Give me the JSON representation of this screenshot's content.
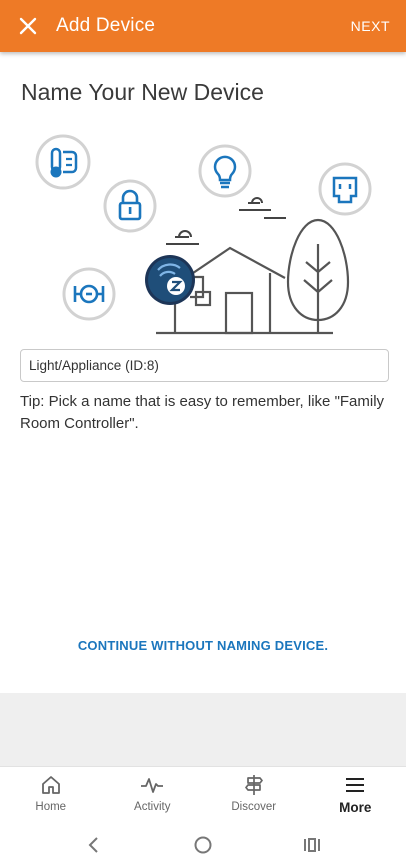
{
  "app_bar": {
    "title": "Add Device",
    "next_label": "NEXT",
    "color": "#ee7a26"
  },
  "content": {
    "heading": "Name Your New Device",
    "name_input_value": "Light/Appliance (ID:8)",
    "tip": "Tip: Pick a name that is easy to remember, like \"Family Room Controller\".",
    "continue_label": "CONTINUE WITHOUT NAMING DEVICE.",
    "link_color": "#1b76bd"
  },
  "illustration": {
    "icons": [
      "thermostat-icon",
      "lock-icon",
      "lightbulb-icon",
      "outlet-icon",
      "valve-icon",
      "zwave-icon",
      "house-icon",
      "tree-icon",
      "cloud-icon"
    ]
  },
  "bottom_nav": {
    "items": [
      {
        "label": "Home",
        "icon": "home-icon"
      },
      {
        "label": "Activity",
        "icon": "activity-icon"
      },
      {
        "label": "Discover",
        "icon": "signpost-icon"
      },
      {
        "label": "More",
        "icon": "menu-icon"
      }
    ],
    "active": "More"
  },
  "system_nav": {
    "icons": [
      "back-icon",
      "home-circle-icon",
      "recents-icon"
    ]
  }
}
